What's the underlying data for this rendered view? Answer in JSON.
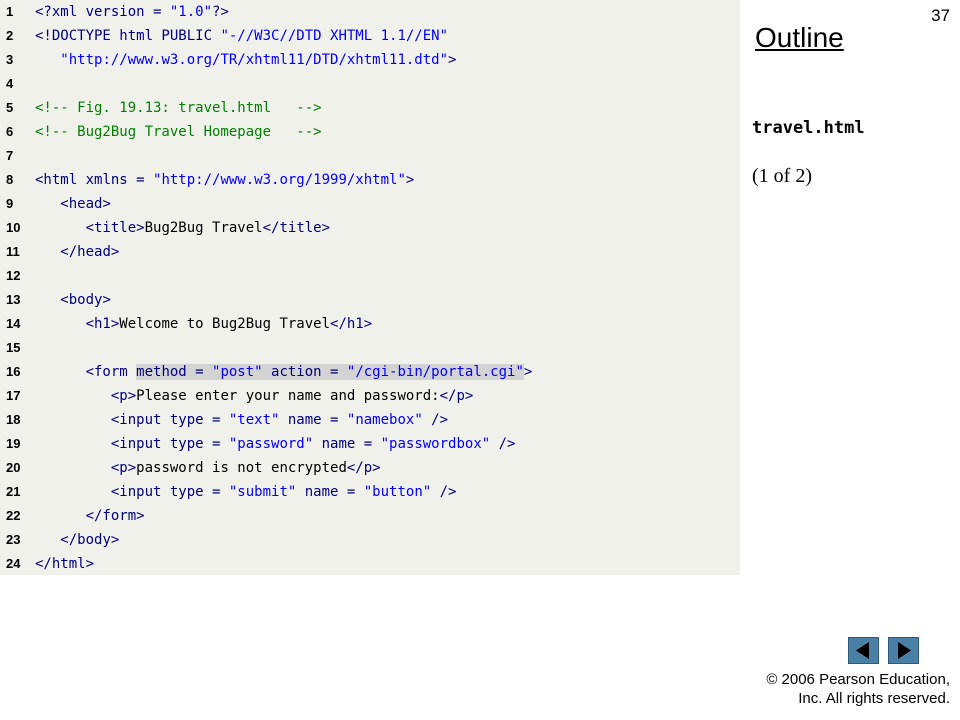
{
  "slide": {
    "page_number": "37",
    "outline_title": "Outline",
    "filename": "travel.html",
    "part": "(1 of 2)",
    "copyright_line1": "© 2006 Pearson Education,",
    "copyright_line2": "Inc.  All rights reserved."
  },
  "nav": {
    "prev_icon": "triangle-left",
    "next_icon": "triangle-right",
    "button_color": "#4a7fa6"
  },
  "code": {
    "line_numbers": [
      "1",
      "2",
      "3",
      "4",
      "5",
      "6",
      "7",
      "8",
      "9",
      "10",
      "11",
      "12",
      "13",
      "14",
      "15",
      "16",
      "17",
      "18",
      "19",
      "20",
      "21",
      "22",
      "23",
      "24"
    ],
    "l1": [
      "<?xml version = ",
      "\"1.0\"",
      "?>"
    ],
    "l2": [
      "<!DOCTYPE html PUBLIC ",
      "\"-//W3C//DTD XHTML 1.1//EN\""
    ],
    "l3": [
      "\"http://www.w3.org/TR/xhtml11/DTD/xhtml11.dtd\"",
      ">"
    ],
    "l5": "<!-- Fig. 19.13: travel.html   -->",
    "l6": "<!-- Bug2Bug Travel Homepage   -->",
    "l8": [
      "<html",
      " xmlns = ",
      "\"http://www.w3.org/1999/xhtml\"",
      ">"
    ],
    "l9": "<head>",
    "l10": [
      "<title>",
      "Bug2Bug Travel",
      "</title>"
    ],
    "l11": "</head>",
    "l13": "<body>",
    "l14": [
      "<h1>",
      "Welcome to Bug2Bug Travel",
      "</h1>"
    ],
    "l16": [
      "<form ",
      "method = ",
      "\"post\"",
      " action = ",
      "\"/cgi-bin/portal.cgi\"",
      ">"
    ],
    "l17": [
      "<p>",
      "Please enter your name and password:",
      "</p>"
    ],
    "l18": [
      "<input",
      " type = ",
      "\"text\"",
      " name = ",
      "\"namebox\"",
      " />"
    ],
    "l19": [
      "<input",
      " type = ",
      "\"password\"",
      " name = ",
      "\"passwordbox\"",
      " />"
    ],
    "l20": [
      "<p>",
      "password is not encrypted",
      "</p>"
    ],
    "l21": [
      "<input",
      " type = ",
      "\"submit\"",
      " name = ",
      "\"button\"",
      " />"
    ],
    "l22": "</form>",
    "l23": "</body>",
    "l24": "</html>"
  }
}
